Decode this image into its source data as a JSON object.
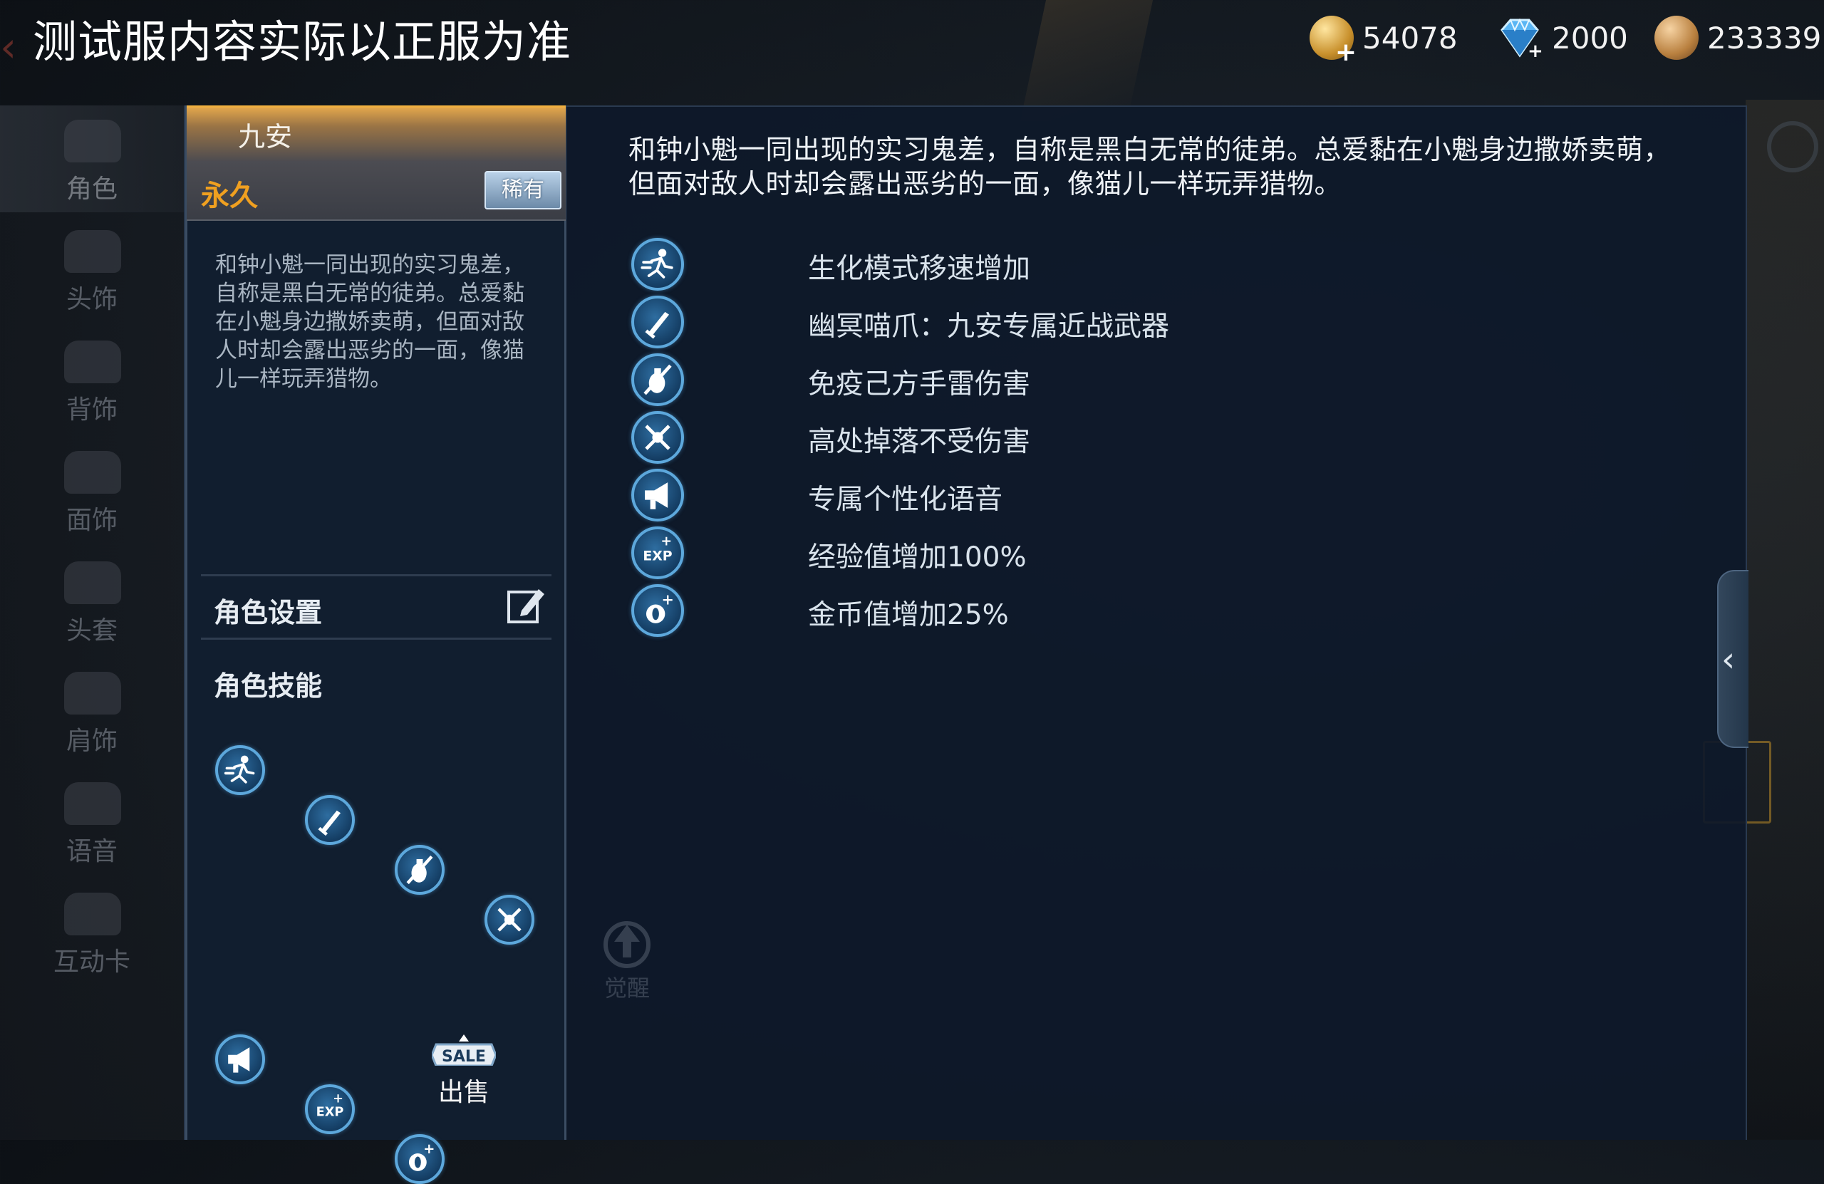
{
  "top_bar": {
    "notice": "测试服内容实际以正服为准",
    "currencies": [
      {
        "name": "gold",
        "icon": "gold-coin-icon",
        "value": "54078"
      },
      {
        "name": "diamond",
        "icon": "diamond-icon",
        "value": "2000"
      },
      {
        "name": "token",
        "icon": "token-coin-icon",
        "value": "233339"
      }
    ]
  },
  "sidebar": {
    "items": [
      {
        "label": "角色",
        "icon": "character-icon",
        "active": true
      },
      {
        "label": "头饰",
        "icon": "headwear-icon"
      },
      {
        "label": "背饰",
        "icon": "back-accessory-icon"
      },
      {
        "label": "面饰",
        "icon": "face-accessory-icon"
      },
      {
        "label": "头套",
        "icon": "hood-icon"
      },
      {
        "label": "肩饰",
        "icon": "shoulder-accessory-icon"
      },
      {
        "label": "语音",
        "icon": "voice-icon"
      },
      {
        "label": "互动卡",
        "icon": "interaction-card-icon"
      }
    ]
  },
  "character": {
    "name": "九安",
    "duration": "永久",
    "rarity": "稀有",
    "description_short": "和钟小魁一同出现的实习鬼差，自称是黑白无常的徒弟。总爱黏在小魁身边撒娇卖萌，但面对敌人时却会露出恶劣的一面，像猫儿一样玩弄猎物。",
    "description_full": "和钟小魁一同出现的实习鬼差，自称是黑白无常的徒弟。总爱黏在小魁身边撒娇卖萌，但面对敌人时却会露出恶劣的一面，像猫儿一样玩弄猎物。"
  },
  "settings": {
    "label": "角色设置",
    "icon": "edit-icon"
  },
  "skills_section": {
    "label": "角色技能"
  },
  "skills": [
    {
      "icon": "running-icon",
      "text": "生化模式移速增加"
    },
    {
      "icon": "knife-icon",
      "text": "幽冥喵爪：九安专属近战武器"
    },
    {
      "icon": "grenade-immune-icon",
      "text": "免疫己方手雷伤害"
    },
    {
      "icon": "fall-immune-icon",
      "text": "高处掉落不受伤害"
    },
    {
      "icon": "megaphone-icon",
      "text": "专属个性化语音"
    },
    {
      "icon": "exp-boost-icon",
      "text": "经验值增加100%"
    },
    {
      "icon": "coin-boost-icon",
      "text": "金币值增加25%"
    }
  ],
  "sale": {
    "sign": "SALE",
    "label": "出售"
  },
  "awaken": {
    "label": "觉醒"
  },
  "colors": {
    "accent_gold": "#f0a020",
    "skill_ring": "#5da8dc",
    "panel_bg": "#0e192a"
  }
}
